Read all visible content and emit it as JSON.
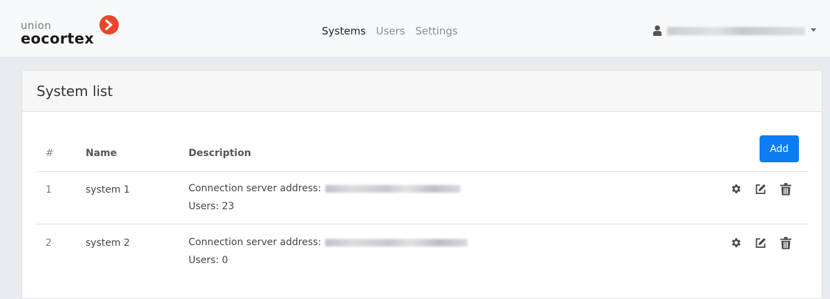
{
  "brand": {
    "small": "union",
    "big": "eocortex",
    "accent": "#e9462b"
  },
  "nav": {
    "items": [
      "Systems",
      "Users",
      "Settings"
    ],
    "active": "Systems"
  },
  "user": {
    "icon": "user-icon",
    "name": "",
    "dropdown_icon": "caret-down-icon"
  },
  "card": {
    "title": "System list",
    "add_label": "Add",
    "add_color": "#0d7cf2"
  },
  "table": {
    "headers": [
      "#",
      "Name",
      "Description"
    ],
    "rows": [
      {
        "index": "1",
        "name": "system 1",
        "address_label": "Connection server address:",
        "address_value": "",
        "users_label": "Users: 23",
        "actions": [
          "gear-icon",
          "edit-icon",
          "trash-icon"
        ]
      },
      {
        "index": "2",
        "name": "system 2",
        "address_label": "Connection server address:",
        "address_value": "",
        "users_label": "Users: 0",
        "actions": [
          "gear-icon",
          "edit-icon",
          "trash-icon"
        ]
      }
    ]
  }
}
